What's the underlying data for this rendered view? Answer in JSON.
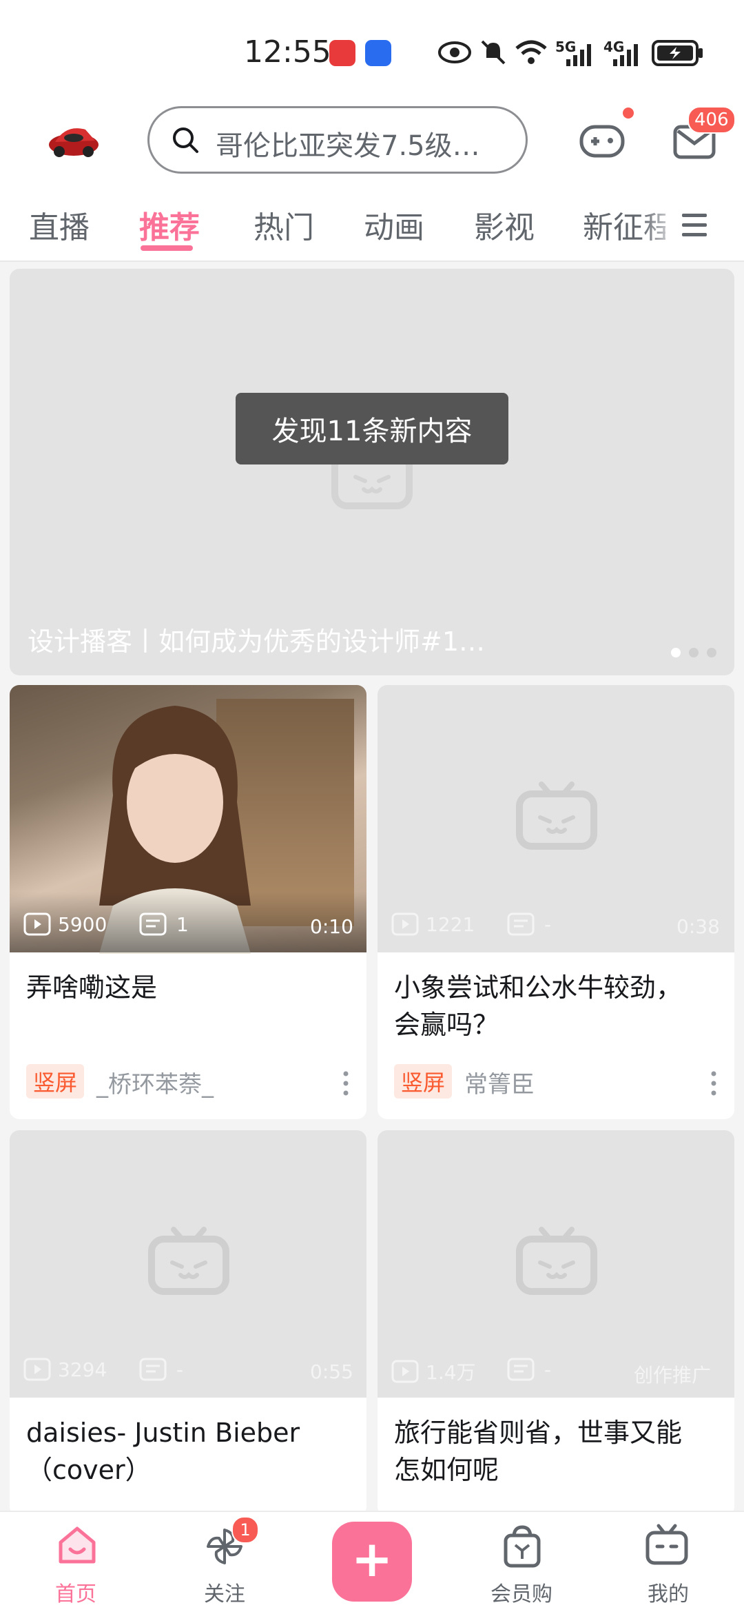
{
  "status_bar": {
    "time": "12:55",
    "net_5g": "5G",
    "net_4g": "4G",
    "icons": [
      "huawei-app-icon",
      "bulb-app-icon",
      "eye-icon",
      "bell-off-icon",
      "wifi-icon",
      "signal-5g-icon",
      "signal-4g-icon",
      "battery-icon"
    ]
  },
  "header": {
    "search_placeholder": "哥伦比亚突发7.5级…",
    "mail_badge": "406",
    "colors": {
      "accent": "#fb7299",
      "badge": "#f85a54"
    }
  },
  "tabs": [
    "直播",
    "推荐",
    "热门",
    "动画",
    "影视",
    "新征程"
  ],
  "active_tab": "推荐",
  "banner": {
    "toast": "发现11条新内容",
    "title": "设计播客丨如何成为优秀的设计师#1…"
  },
  "feed": [
    {
      "views": "5900",
      "danmaku": "1",
      "duration": "0:10",
      "title": "弄啥嘞这是",
      "tag": "竖屏",
      "author": "_桥环苯萘_"
    },
    {
      "views": "1221",
      "danmaku": "-",
      "duration": "0:38",
      "title_line1": "小象尝试和公水牛较劲，",
      "title_line2": "会赢吗？",
      "tag": "竖屏",
      "author": "常箐臣"
    },
    {
      "views": "3294",
      "danmaku": "-",
      "duration": "0:55",
      "title_line1": "daisies- Justin Bieber",
      "title_line2": "（cover）"
    },
    {
      "views": "1.4万",
      "danmaku": "-",
      "duration": "创作推广",
      "title_line1": "旅行能省则省，世事又能",
      "title_line2": "怎如何呢"
    }
  ],
  "bottom_nav": {
    "home": "首页",
    "follow": "关注",
    "follow_badge": "1",
    "vip_shop": "会员购",
    "mine": "我的",
    "plus": "+"
  }
}
